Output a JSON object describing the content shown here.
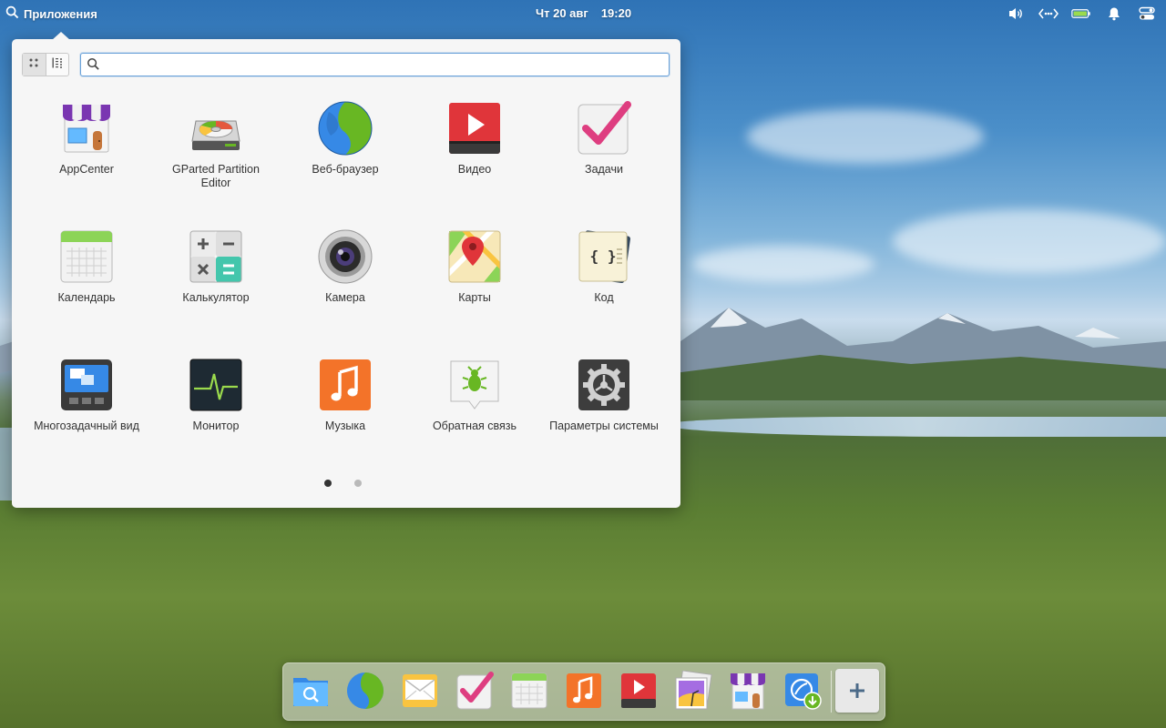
{
  "panel": {
    "applications_label": "Приложения",
    "date": "Чт 20 авг",
    "time": "19:20"
  },
  "launcher": {
    "search": {
      "value": "",
      "placeholder": ""
    },
    "view_modes": [
      "grid-view-icon",
      "category-view-icon"
    ],
    "active_view": "grid",
    "apps": [
      {
        "label": "AppCenter",
        "icon": "appcenter-icon"
      },
      {
        "label": "GParted Partition Editor",
        "icon": "gparted-icon"
      },
      {
        "label": "Веб-браузер",
        "icon": "web-browser-icon"
      },
      {
        "label": "Видео",
        "icon": "videos-icon"
      },
      {
        "label": "Задачи",
        "icon": "tasks-icon"
      },
      {
        "label": "Календарь",
        "icon": "calendar-icon"
      },
      {
        "label": "Калькулятор",
        "icon": "calculator-icon"
      },
      {
        "label": "Камера",
        "icon": "camera-icon"
      },
      {
        "label": "Карты",
        "icon": "maps-icon"
      },
      {
        "label": "Код",
        "icon": "code-icon"
      },
      {
        "label": "Многозадачный вид",
        "icon": "multitasking-view-icon"
      },
      {
        "label": "Монитор",
        "icon": "monitor-icon"
      },
      {
        "label": "Музыка",
        "icon": "music-icon"
      },
      {
        "label": "Обратная связь",
        "icon": "feedback-icon"
      },
      {
        "label": "Параметры системы",
        "icon": "system-settings-icon"
      }
    ],
    "pages": 2,
    "current_page": 1
  },
  "dock": {
    "items": [
      "files-icon",
      "web-browser-icon",
      "mail-icon",
      "tasks-icon",
      "calendar-icon",
      "music-icon",
      "videos-icon",
      "photos-icon",
      "appcenter-icon",
      "installer-icon"
    ],
    "add_button_icon": "plus-icon"
  },
  "colors": {
    "accent": "#3689e6",
    "panel_text": "#ffffff",
    "popover_bg": "#f6f6f6"
  }
}
